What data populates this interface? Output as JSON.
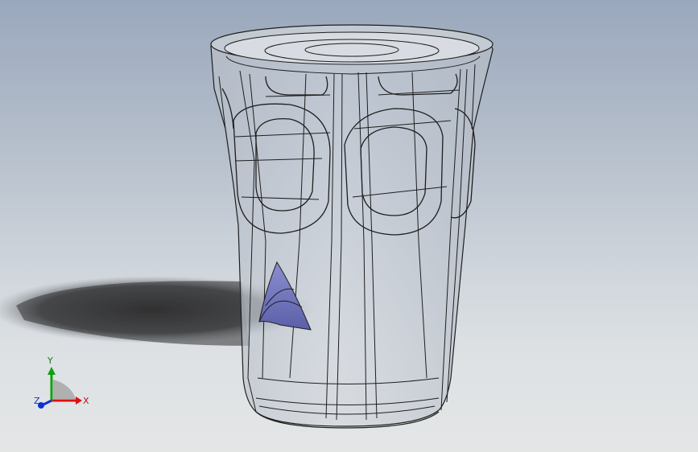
{
  "viewport": {
    "background_top": "#9aa8bd",
    "background_bottom": "#e4e6e6"
  },
  "model": {
    "body_color": "#c9ced6",
    "edge_color": "#1c1c1c",
    "accent_face_color": "#6f73b8"
  },
  "triad": {
    "x_label": "X",
    "y_label": "Y",
    "z_label": "Z",
    "x_color": "#e01010",
    "y_color": "#10a010",
    "z_color": "#1030d0"
  }
}
